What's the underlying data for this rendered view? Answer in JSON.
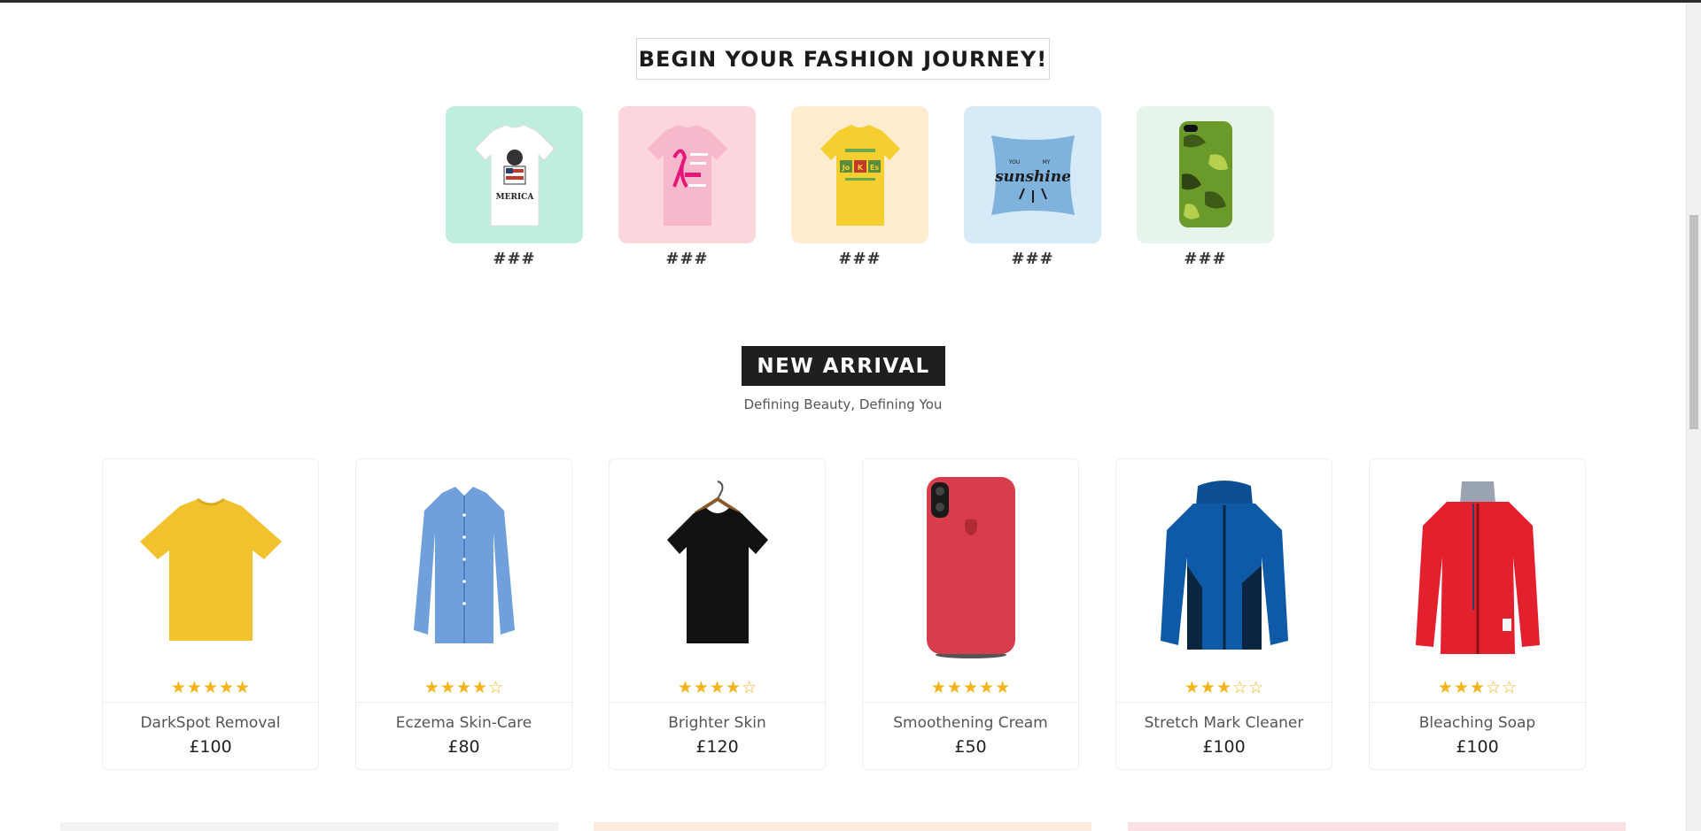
{
  "journey": {
    "title": "BEGIN YOUR FASHION JOURNEY!",
    "categories": [
      {
        "label": "###",
        "bg": "#bfeedd",
        "icon": "merica-tshirt-image"
      },
      {
        "label": "###",
        "bg": "#fcd6dc",
        "icon": "pink-ribbon-tshirt-image"
      },
      {
        "label": "###",
        "bg": "#fdeccf",
        "icon": "yellow-jokes-tshirt-image"
      },
      {
        "label": "###",
        "bg": "#d6eaf8",
        "icon": "sunshine-pillow-image"
      },
      {
        "label": "###",
        "bg": "#e6f4ec",
        "icon": "camo-phone-case-image"
      }
    ]
  },
  "arrival": {
    "title": "NEW ARRIVAL",
    "subtitle": "Defining Beauty, Defining You"
  },
  "products": [
    {
      "name": "DarkSpot Removal",
      "price": "£100",
      "rating": 5,
      "image": "yellow-tshirt-image"
    },
    {
      "name": "Eczema Skin-Care",
      "price": "£80",
      "rating": 4,
      "image": "blue-shirt-image"
    },
    {
      "name": "Brighter Skin",
      "price": "£120",
      "rating": 4,
      "image": "black-tshirt-image"
    },
    {
      "name": "Smoothening Cream",
      "price": "£50",
      "rating": 5,
      "image": "red-phone-case-image"
    },
    {
      "name": "Stretch Mark Cleaner",
      "price": "£100",
      "rating": 3,
      "image": "blue-jacket-image"
    },
    {
      "name": "Bleaching Soap",
      "price": "£100",
      "rating": 3,
      "image": "red-jacket-image"
    }
  ],
  "colors": {
    "star": "#f4b41a",
    "dark": "#1f1f1f"
  }
}
